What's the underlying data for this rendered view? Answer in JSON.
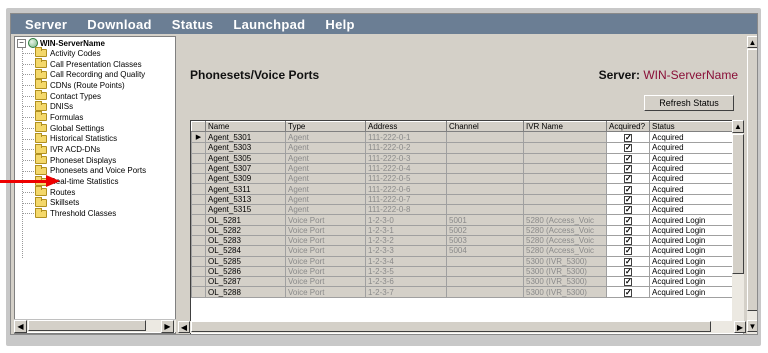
{
  "menu": [
    "Server",
    "Download",
    "Status",
    "Launchpad",
    "Help"
  ],
  "tree": {
    "root": "WIN-ServerName",
    "items": [
      "Activity Codes",
      "Call Presentation Classes",
      "Call Recording and Quality",
      "CDNs (Route Points)",
      "Contact Types",
      "DNISs",
      "Formulas",
      "Global Settings",
      "Historical Statistics",
      "IVR ACD-DNs",
      "Phoneset Displays",
      "Phonesets and Voice Ports",
      "Real-time Statistics",
      "Routes",
      "Skillsets",
      "Threshold Classes"
    ]
  },
  "page": {
    "title": "Phonesets/Voice Ports",
    "server_label": "Server:",
    "server_name": "WIN-ServerName",
    "refresh_button": "Refresh Status"
  },
  "table": {
    "columns": [
      "Name",
      "Type",
      "Address",
      "Channel",
      "IVR Name",
      "Acquired?",
      "Status"
    ],
    "rows": [
      {
        "name": "Agent_5301",
        "type": "Agent",
        "address": "111-222-0-1",
        "channel": "",
        "ivr": "",
        "acquired": true,
        "status": "Acquired",
        "current": true
      },
      {
        "name": "Agent_5303",
        "type": "Agent",
        "address": "111-222-0-2",
        "channel": "",
        "ivr": "",
        "acquired": true,
        "status": "Acquired"
      },
      {
        "name": "Agent_5305",
        "type": "Agent",
        "address": "111-222-0-3",
        "channel": "",
        "ivr": "",
        "acquired": true,
        "status": "Acquired"
      },
      {
        "name": "Agent_5307",
        "type": "Agent",
        "address": "111-222-0-4",
        "channel": "",
        "ivr": "",
        "acquired": true,
        "status": "Acquired"
      },
      {
        "name": "Agent_5309",
        "type": "Agent",
        "address": "111-222-0-5",
        "channel": "",
        "ivr": "",
        "acquired": true,
        "status": "Acquired"
      },
      {
        "name": "Agent_5311",
        "type": "Agent",
        "address": "111-222-0-6",
        "channel": "",
        "ivr": "",
        "acquired": true,
        "status": "Acquired"
      },
      {
        "name": "Agent_5313",
        "type": "Agent",
        "address": "111-222-0-7",
        "channel": "",
        "ivr": "",
        "acquired": true,
        "status": "Acquired"
      },
      {
        "name": "Agent_5315",
        "type": "Agent",
        "address": "111-222-0-8",
        "channel": "",
        "ivr": "",
        "acquired": true,
        "status": "Acquired"
      },
      {
        "name": "OL_5281",
        "type": "Voice Port",
        "address": "1-2-3-0",
        "channel": "5001",
        "ivr": "5280 (Access_Voic",
        "acquired": true,
        "status": "Acquired Login"
      },
      {
        "name": "OL_5282",
        "type": "Voice Port",
        "address": "1-2-3-1",
        "channel": "5002",
        "ivr": "5280 (Access_Voic",
        "acquired": true,
        "status": "Acquired Login"
      },
      {
        "name": "OL_5283",
        "type": "Voice Port",
        "address": "1-2-3-2",
        "channel": "5003",
        "ivr": "5280 (Access_Voic",
        "acquired": true,
        "status": "Acquired Login"
      },
      {
        "name": "OL_5284",
        "type": "Voice Port",
        "address": "1-2-3-3",
        "channel": "5004",
        "ivr": "5280 (Access_Voic",
        "acquired": true,
        "status": "Acquired Login"
      },
      {
        "name": "OL_5285",
        "type": "Voice Port",
        "address": "1-2-3-4",
        "channel": "",
        "ivr": "5300 (IVR_5300)",
        "acquired": true,
        "status": "Acquired Login"
      },
      {
        "name": "OL_5286",
        "type": "Voice Port",
        "address": "1-2-3-5",
        "channel": "",
        "ivr": "5300 (IVR_5300)",
        "acquired": true,
        "status": "Acquired Login"
      },
      {
        "name": "OL_5287",
        "type": "Voice Port",
        "address": "1-2-3-6",
        "channel": "",
        "ivr": "5300 (IVR_5300)",
        "acquired": true,
        "status": "Acquired Login"
      },
      {
        "name": "OL_5288",
        "type": "Voice Port",
        "address": "1-2-3-7",
        "channel": "",
        "ivr": "5300 (IVR_5300)",
        "acquired": true,
        "status": "Acquired Login"
      }
    ]
  },
  "colors": {
    "menubar": "#6b7e94",
    "server_name": "#8a1038",
    "pointer": "#e00000"
  },
  "icons": {
    "tree_root": "globe-icon",
    "tree_item": "folder-icon",
    "pointer": "red-arrow-icon"
  }
}
